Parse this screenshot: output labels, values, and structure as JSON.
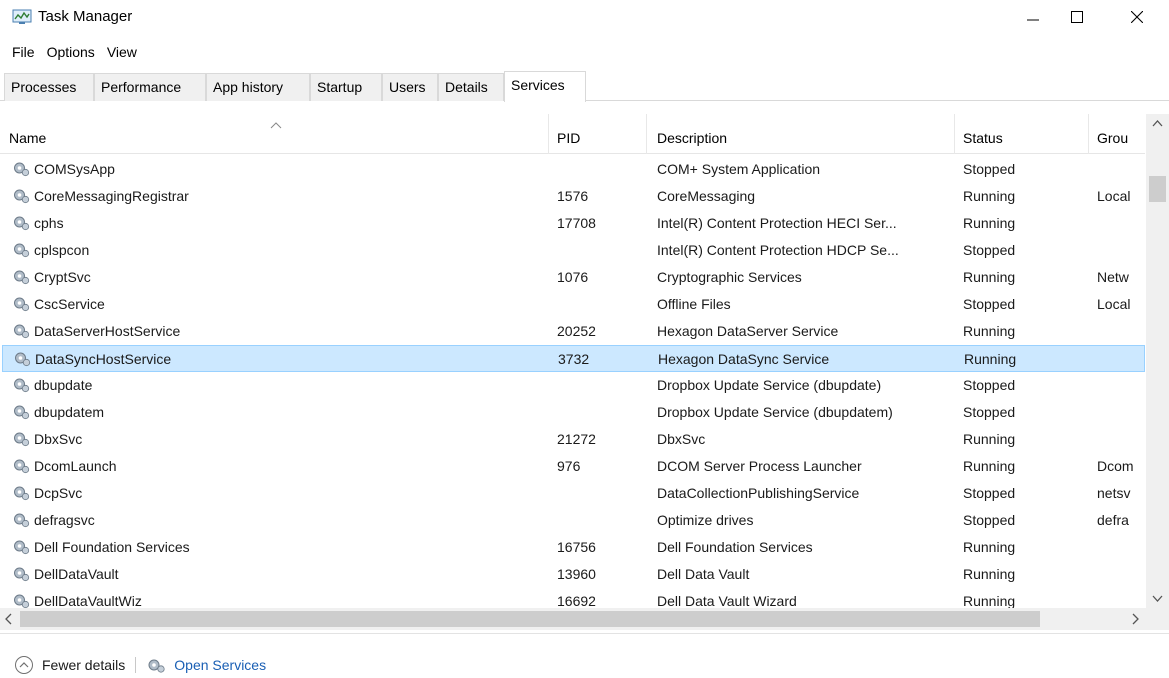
{
  "window": {
    "title": "Task Manager"
  },
  "menu": [
    "File",
    "Options",
    "View"
  ],
  "tabs": [
    {
      "label": "Processes"
    },
    {
      "label": "Performance"
    },
    {
      "label": "App history"
    },
    {
      "label": "Startup"
    },
    {
      "label": "Users"
    },
    {
      "label": "Details"
    },
    {
      "label": "Services",
      "active": true
    }
  ],
  "table": {
    "columns": [
      "Name",
      "PID",
      "Description",
      "Status",
      "Grou"
    ],
    "sorted_column": "Name",
    "rows": [
      {
        "name": "COMSysApp",
        "pid": "",
        "description": "COM+ System Application",
        "status": "Stopped",
        "group": ""
      },
      {
        "name": "CoreMessagingRegistrar",
        "pid": "1576",
        "description": "CoreMessaging",
        "status": "Running",
        "group": "Local"
      },
      {
        "name": "cphs",
        "pid": "17708",
        "description": "Intel(R) Content Protection HECI Ser...",
        "status": "Running",
        "group": ""
      },
      {
        "name": "cplspcon",
        "pid": "",
        "description": "Intel(R) Content Protection HDCP Se...",
        "status": "Stopped",
        "group": ""
      },
      {
        "name": "CryptSvc",
        "pid": "1076",
        "description": "Cryptographic Services",
        "status": "Running",
        "group": "Netw"
      },
      {
        "name": "CscService",
        "pid": "",
        "description": "Offline Files",
        "status": "Stopped",
        "group": "Local"
      },
      {
        "name": "DataServerHostService",
        "pid": "20252",
        "description": "Hexagon DataServer Service",
        "status": "Running",
        "group": ""
      },
      {
        "name": "DataSyncHostService",
        "pid": "3732",
        "description": "Hexagon DataSync Service",
        "status": "Running",
        "group": "",
        "selected": true
      },
      {
        "name": "dbupdate",
        "pid": "",
        "description": "Dropbox Update Service (dbupdate)",
        "status": "Stopped",
        "group": ""
      },
      {
        "name": "dbupdatem",
        "pid": "",
        "description": "Dropbox Update Service (dbupdatem)",
        "status": "Stopped",
        "group": ""
      },
      {
        "name": "DbxSvc",
        "pid": "21272",
        "description": "DbxSvc",
        "status": "Running",
        "group": ""
      },
      {
        "name": "DcomLaunch",
        "pid": "976",
        "description": "DCOM Server Process Launcher",
        "status": "Running",
        "group": "Dcom"
      },
      {
        "name": "DcpSvc",
        "pid": "",
        "description": "DataCollectionPublishingService",
        "status": "Stopped",
        "group": "netsv"
      },
      {
        "name": "defragsvc",
        "pid": "",
        "description": "Optimize drives",
        "status": "Stopped",
        "group": "defra"
      },
      {
        "name": "Dell Foundation Services",
        "pid": "16756",
        "description": "Dell Foundation Services",
        "status": "Running",
        "group": ""
      },
      {
        "name": "DellDataVault",
        "pid": "13960",
        "description": "Dell Data Vault",
        "status": "Running",
        "group": ""
      },
      {
        "name": "DellDataVaultWiz",
        "pid": "16692",
        "description": "Dell Data Vault Wizard",
        "status": "Running",
        "group": ""
      }
    ]
  },
  "footer": {
    "fewer_details": "Fewer details",
    "open_services": "Open Services"
  },
  "colors": {
    "selection_bg": "#cce8ff",
    "selection_border": "#99d1ff",
    "link": "#1a5fb4"
  }
}
